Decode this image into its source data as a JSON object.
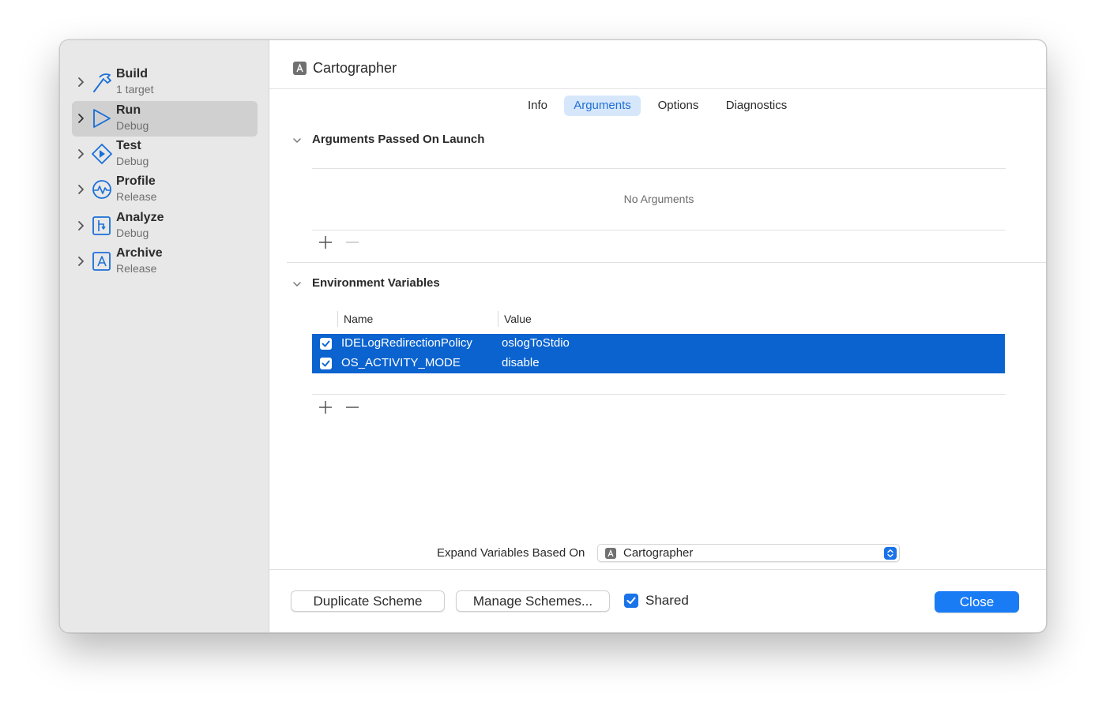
{
  "scheme_name": "Cartographer",
  "sidebar": {
    "items": [
      {
        "title": "Build",
        "subtitle": "1 target",
        "icon": "hammer-icon"
      },
      {
        "title": "Run",
        "subtitle": "Debug",
        "icon": "play-icon",
        "selected": true
      },
      {
        "title": "Test",
        "subtitle": "Debug",
        "icon": "diamond-play-icon"
      },
      {
        "title": "Profile",
        "subtitle": "Release",
        "icon": "gauge-icon"
      },
      {
        "title": "Analyze",
        "subtitle": "Debug",
        "icon": "analyze-icon"
      },
      {
        "title": "Archive",
        "subtitle": "Release",
        "icon": "archive-icon"
      }
    ]
  },
  "tabs": [
    {
      "label": "Info"
    },
    {
      "label": "Arguments",
      "active": true
    },
    {
      "label": "Options"
    },
    {
      "label": "Diagnostics"
    }
  ],
  "arguments_section": {
    "title": "Arguments Passed On Launch",
    "empty_text": "No Arguments"
  },
  "env_section": {
    "title": "Environment Variables",
    "columns": {
      "name": "Name",
      "value": "Value"
    },
    "rows": [
      {
        "name": "IDELogRedirectionPolicy",
        "value": "oslogToStdio",
        "checked": true
      },
      {
        "name": "OS_ACTIVITY_MODE",
        "value": "disable",
        "checked": true
      }
    ]
  },
  "expand_variables": {
    "label": "Expand Variables Based On",
    "value": "Cartographer"
  },
  "footer": {
    "duplicate_label": "Duplicate Scheme",
    "manage_label": "Manage Schemes...",
    "shared_label": "Shared",
    "shared_checked": true,
    "close_label": "Close"
  },
  "colors": {
    "accent": "#1a7cf5",
    "selection": "#0b63cf",
    "icon_blue": "#1a6fd8"
  }
}
